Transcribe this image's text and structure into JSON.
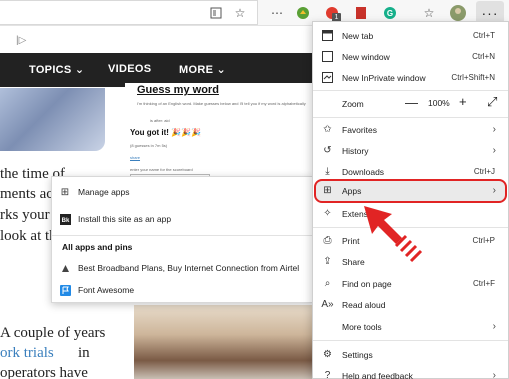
{
  "toolbar": {
    "back_icon": "tab-bar-icon",
    "reader_icon": "reader-view-icon",
    "favorite_icon": "star-icon",
    "extension_badge": "1",
    "more_label": "···"
  },
  "page": {
    "nav": [
      "TOPICS",
      "VIDEOS",
      "MORE"
    ],
    "game_title": "Guess my word",
    "game_line1": "I'm thinking of an English word. Make guesses below and I'll tell you if my word is alphabetically",
    "game_line2": "is after: aid",
    "got_it": "You got it!",
    "game_guesses": "(8 guesses in 7m 5s)",
    "game_link": "share",
    "game_note": "enter your name for the scoreboard",
    "left_text": [
      "the time of",
      "ments acr",
      "rks your d",
      "look at th"
    ],
    "bottom_text": [
      "A couple of years",
      "ork trials",
      "in",
      "operators have"
    ]
  },
  "apps_submenu": {
    "manage": "Manage apps",
    "install": "Install this site as an app",
    "header": "All apps and pins",
    "items": [
      {
        "label": "Best Broadband Plans, Buy Internet Connection from Airtel",
        "icon": "airtel-icon"
      },
      {
        "label": "Font Awesome",
        "icon": "font-awesome-flag-icon"
      }
    ]
  },
  "menu": {
    "new_tab": {
      "label": "New tab",
      "shortcut": "Ctrl+T"
    },
    "new_window": {
      "label": "New window",
      "shortcut": "Ctrl+N"
    },
    "inprivate": {
      "label": "New InPrivate window",
      "shortcut": "Ctrl+Shift+N"
    },
    "zoom": {
      "label": "Zoom",
      "minus": "—",
      "value": "100%",
      "plus": "+"
    },
    "favorites": {
      "label": "Favorites"
    },
    "history": {
      "label": "History"
    },
    "downloads": {
      "label": "Downloads",
      "shortcut": "Ctrl+J"
    },
    "apps": {
      "label": "Apps"
    },
    "extensions": {
      "label": "Extensions"
    },
    "print": {
      "label": "Print",
      "shortcut": "Ctrl+P"
    },
    "share": {
      "label": "Share"
    },
    "find": {
      "label": "Find on page",
      "shortcut": "Ctrl+F"
    },
    "read_aloud": {
      "label": "Read aloud"
    },
    "more_tools": {
      "label": "More tools"
    },
    "settings": {
      "label": "Settings"
    },
    "help": {
      "label": "Help and feedback"
    }
  },
  "colors": {
    "highlight_border": "#e12424",
    "arrow": "#e12424",
    "nav_bg": "#222222",
    "link": "#3a7fbd"
  }
}
